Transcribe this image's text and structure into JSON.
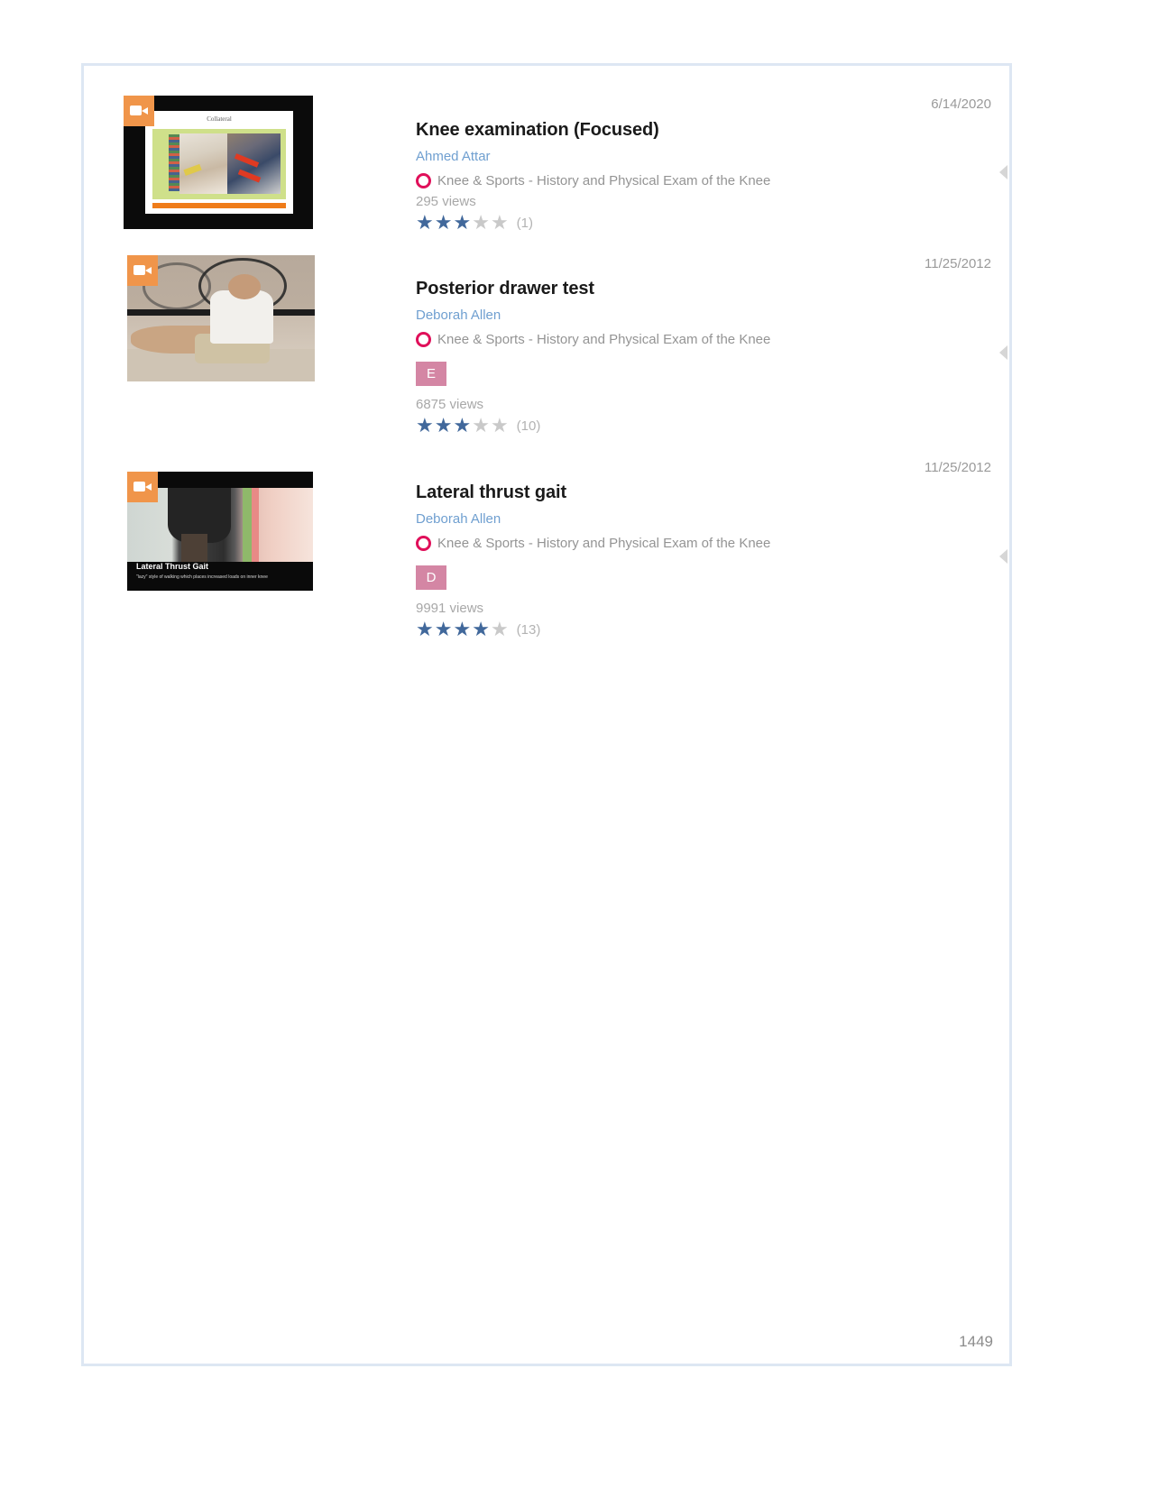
{
  "page": {
    "footer_number": "1449"
  },
  "results": [
    {
      "date": "6/14/2020",
      "title": "Knee examination (Focused)",
      "author": "Ahmed Attar",
      "course": "Knee & Sports - History and Physical Exam of the Knee",
      "chip": "",
      "views": "295 views",
      "rating_filled": 3,
      "rating_total": 5,
      "rating_count": "(1)",
      "thumb_caption": "Collateral",
      "thumb_subcaption": ""
    },
    {
      "date": "11/25/2012",
      "title": "Posterior drawer test",
      "author": "Deborah Allen",
      "course": "Knee & Sports - History and Physical Exam of the Knee",
      "chip": "E",
      "views": "6875 views",
      "rating_filled": 3,
      "rating_total": 5,
      "rating_count": "(10)",
      "thumb_caption": "",
      "thumb_subcaption": ""
    },
    {
      "date": "11/25/2012",
      "title": "Lateral thrust gait",
      "author": "Deborah Allen",
      "course": "Knee & Sports - History and Physical Exam of the Knee",
      "chip": "D",
      "views": "9991 views",
      "rating_filled": 4,
      "rating_total": 5,
      "rating_count": "(13)",
      "thumb_caption": "Lateral Thrust Gait",
      "thumb_subcaption": "\"lazy\" style of walking which places increased loads on inner knee"
    }
  ],
  "icons": {
    "video": "video-camera-icon",
    "collapse": "collapse-arrow-icon",
    "course_marker": "ring-icon"
  },
  "colors": {
    "accent_orange": "#f0954a",
    "course_ring": "#e0105a",
    "chip": "#d486a4",
    "star_on": "#41689b",
    "star_off": "#c9c9c9",
    "author_link": "#6f9fd0",
    "frame_border": "#dde7f3"
  }
}
